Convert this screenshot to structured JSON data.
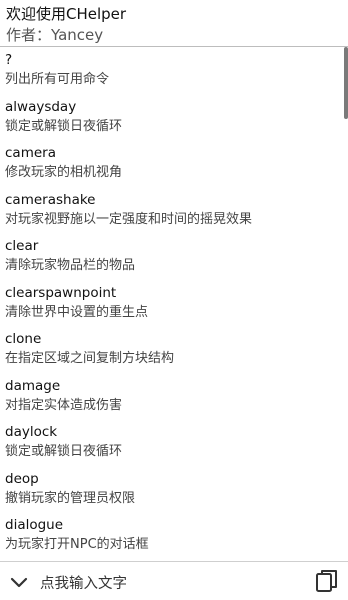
{
  "header": {
    "title": "欢迎使用CHelper",
    "author_label": "作者：",
    "author_name": "Yancey"
  },
  "commands": [
    {
      "name": "?",
      "desc": "列出所有可用命令"
    },
    {
      "name": "alwaysday",
      "desc": "锁定或解锁日夜循环"
    },
    {
      "name": "camera",
      "desc": "修改玩家的相机视角"
    },
    {
      "name": "camerashake",
      "desc": "对玩家视野施以一定强度和时间的摇晃效果"
    },
    {
      "name": "clear",
      "desc": "清除玩家物品栏的物品"
    },
    {
      "name": "clearspawnpoint",
      "desc": "清除世界中设置的重生点"
    },
    {
      "name": "clone",
      "desc": "在指定区域之间复制方块结构"
    },
    {
      "name": "damage",
      "desc": "对指定实体造成伤害"
    },
    {
      "name": "daylock",
      "desc": "锁定或解锁日夜循环"
    },
    {
      "name": "deop",
      "desc": "撤销玩家的管理员权限"
    },
    {
      "name": "dialogue",
      "desc": "为玩家打开NPC的对话框"
    }
  ],
  "bottom_bar": {
    "input_label": "点我输入文字",
    "expand_icon": "chevron-down-icon",
    "copy_icon": "copy-icon"
  },
  "colors": {
    "background": "#ffffff",
    "text_primary": "#111111",
    "text_secondary": "#444444",
    "divider": "#bdbdbd",
    "scrollbar": "#7a7a7a"
  }
}
